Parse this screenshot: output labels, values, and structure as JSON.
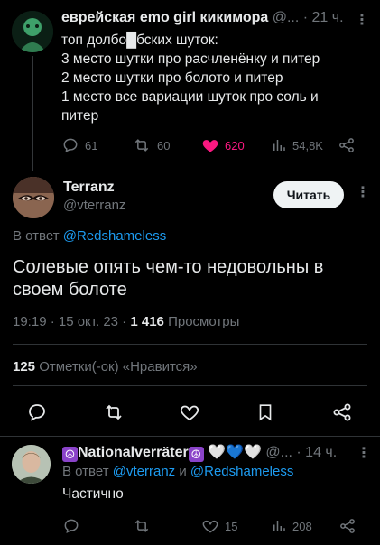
{
  "tweet1": {
    "display_name": "еврейская emo girl кикимора",
    "handle_time": " @... · 21 ч.",
    "lines": [
      "топ долбо█бских шуток:",
      "3 место шутки про расчленёнку и питер",
      "2 место шутки про болото и питер",
      "1 место все вариации шуток про соль и",
      "питер"
    ],
    "replies": "61",
    "retweets": "60",
    "likes": "620",
    "views": "54,8K",
    "like_color": "#f91880"
  },
  "tweet2": {
    "display_name": "Terranz",
    "handle": "@vterranz",
    "follow_label": "Читать",
    "replying_prefix": "В ответ",
    "replying_to": "@Redshameless",
    "text": "Солевые опять чем-то недовольны в своем болоте",
    "time": "19:19 · 15 окт. 23 · ",
    "views_count": "1 416",
    "views_label": " Просмотры",
    "likes_count": "125",
    "likes_label": " Отметки(-ок) «Нравится»"
  },
  "tweet3": {
    "display_name": "Nationalverräter",
    "hearts": "🤍💙🤍",
    "handle_time": " @... · 14 ч.",
    "replying_prefix": "В ответ ",
    "replying_to_1": "@vterranz",
    "replying_and": " и ",
    "replying_to_2": "@Redshameless",
    "text": "Частично",
    "likes": "15",
    "views": "208"
  },
  "colors": {
    "background": "#000000",
    "accent": "#1d9bf0",
    "muted": "#71767b"
  }
}
